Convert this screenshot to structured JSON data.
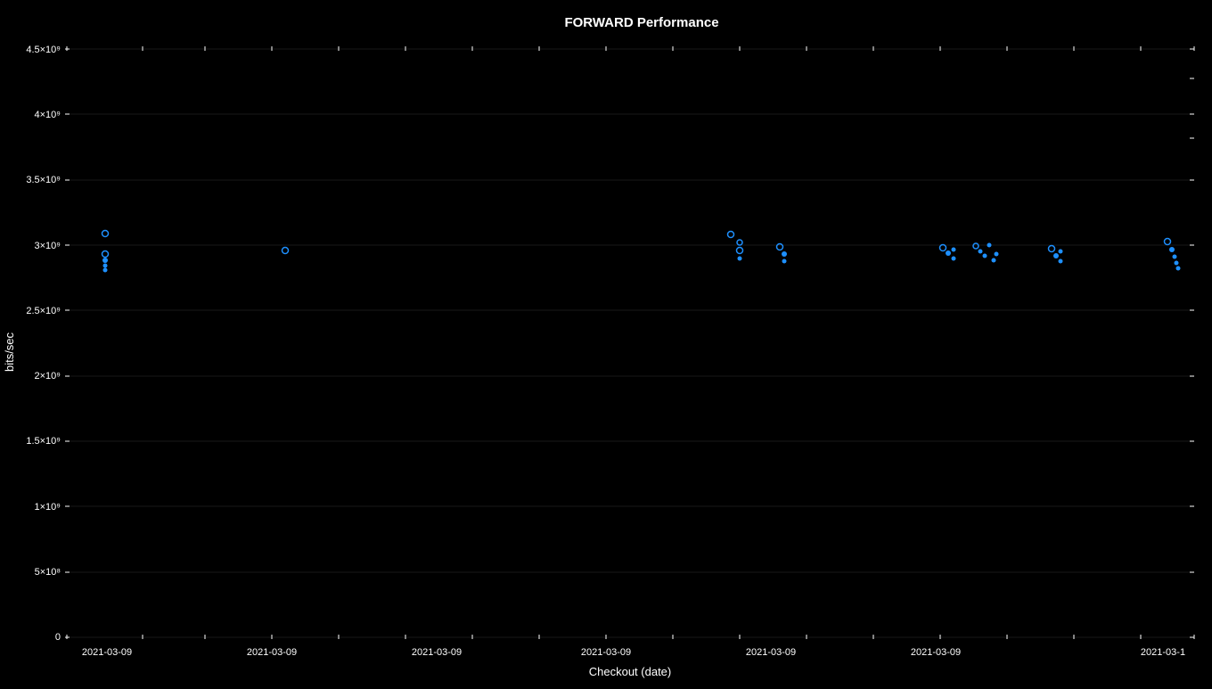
{
  "chart": {
    "title": "FORWARD Performance",
    "x_axis_label": "Checkout (date)",
    "y_axis_label": "bits/sec",
    "y_ticks": [
      {
        "value": 0,
        "label": "0"
      },
      {
        "value": 1,
        "label": "5×10⁸"
      },
      {
        "value": 2,
        "label": "1×10⁹"
      },
      {
        "value": 3,
        "label": "1.5×10⁹"
      },
      {
        "value": 4,
        "label": "2×10⁹"
      },
      {
        "value": 5,
        "label": "2.5×10⁹"
      },
      {
        "value": 6,
        "label": "3×10⁹"
      },
      {
        "value": 7,
        "label": "3.5×10⁹"
      },
      {
        "value": 8,
        "label": "4×10⁹"
      },
      {
        "value": 9,
        "label": "4.5×10⁹"
      }
    ],
    "x_date_label": "2021-03-09",
    "accent_color": "#1e90ff",
    "bg_color": "#000000",
    "axis_color": "#ffffff"
  }
}
